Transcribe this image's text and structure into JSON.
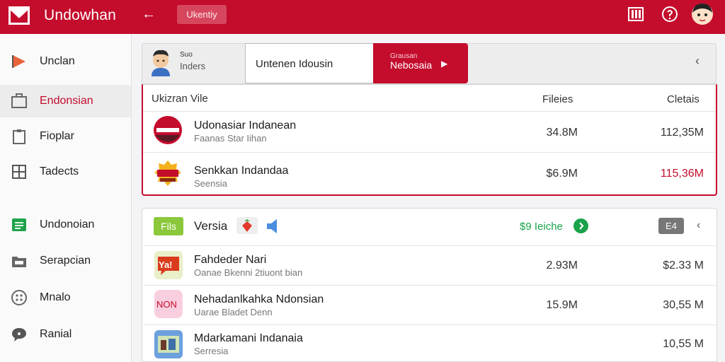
{
  "app": {
    "title": "Undowhan",
    "top_chip": "Ukentiy"
  },
  "colors": {
    "brand": "#c40c2c",
    "success": "#19a34a",
    "accent_green": "#8bc83c"
  },
  "sidebar": {
    "items": [
      {
        "label": "Unclan",
        "icon": "flag-icon",
        "active": false
      },
      {
        "label": "Endonsian",
        "icon": "briefcase-icon",
        "active": true
      },
      {
        "label": "Fioplar",
        "icon": "clipboard-icon",
        "active": false
      },
      {
        "label": "Tadects",
        "icon": "grid-icon",
        "active": false
      },
      {
        "label": "Undonoian",
        "icon": "spreadsheet-icon",
        "active": false
      },
      {
        "label": "Serapcian",
        "icon": "folder-icon",
        "active": false
      },
      {
        "label": "Mnalo",
        "icon": "dots-circle-icon",
        "active": false
      },
      {
        "label": "Ranial",
        "icon": "chat-bubble-icon",
        "active": false
      }
    ]
  },
  "panel1": {
    "mini_top": "Suo",
    "mini_bottom": "Inders",
    "input_value": "Untenen Idousin",
    "cta_small": "Grausan",
    "cta_label": "Nebosaia",
    "columns": {
      "name": "Ukizran Vile",
      "files": "Fileies",
      "cost": "Cletais"
    },
    "rows": [
      {
        "title": "Udonasiar Indanean",
        "sub": "Faanas Star Iihan",
        "files": "34.8M",
        "cost": "112,35M",
        "cost_highlight": false
      },
      {
        "title": "Senkkan Indandaa",
        "sub": "Seensia",
        "files": "$6.9M",
        "cost": "115,36M",
        "cost_highlight": true
      }
    ]
  },
  "panel2": {
    "pill": "Fils",
    "title": "Versia",
    "status": "$9 Ieiche",
    "button": "E4",
    "rows": [
      {
        "title": "Fahdeder Nari",
        "sub": "Oanae Bkenni 2tiuont bian",
        "files": "2.93M",
        "cost": "$2.33 M",
        "badge": "Ya!"
      },
      {
        "title": "Nehadanlkahka Ndonsian",
        "sub": "Uarae Bladet Denn",
        "files": "15.9M",
        "cost": "30,55 M",
        "badge": "NON"
      },
      {
        "title": "Mdarkamani Indanaia",
        "sub": "Serresia",
        "files": "",
        "cost": "10,55 M",
        "badge": ""
      }
    ]
  }
}
